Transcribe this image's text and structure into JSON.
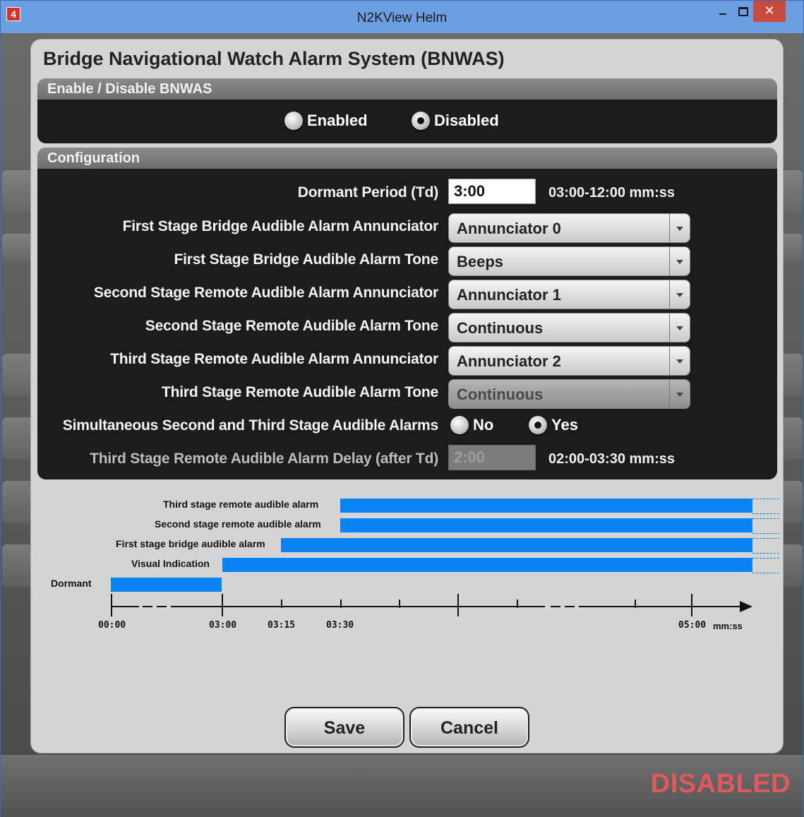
{
  "window": {
    "title": "N2KView Helm",
    "icon_glyph": "4",
    "close_glyph": "✕"
  },
  "status": {
    "disabled_label": "DISABLED",
    "color": "#e05a5a"
  },
  "dialog": {
    "title": "Bridge Navigational Watch Alarm System (BNWAS)",
    "enable_panel": {
      "header": "Enable / Disable BNWAS",
      "options": [
        {
          "label": "Enabled",
          "selected": false
        },
        {
          "label": "Disabled",
          "selected": true
        }
      ]
    },
    "config_panel": {
      "header": "Configuration",
      "dormant_period": {
        "label": "Dormant Period (Td)",
        "value": "3:00",
        "range": "03:00-12:00 mm:ss"
      },
      "selects": [
        {
          "label": "First Stage Bridge Audible Alarm Annunciator",
          "value": "Annunciator 0",
          "disabled": false
        },
        {
          "label": "First Stage Bridge Audible Alarm Tone",
          "value": "Beeps",
          "disabled": false
        },
        {
          "label": "Second Stage Remote Audible Alarm Annunciator",
          "value": "Annunciator 1",
          "disabled": false
        },
        {
          "label": "Second Stage Remote Audible Alarm Tone",
          "value": "Continuous",
          "disabled": false
        },
        {
          "label": "Third Stage Remote Audible Alarm Annunciator",
          "value": "Annunciator 2",
          "disabled": false
        },
        {
          "label": "Third Stage Remote Audible Alarm Tone",
          "value": "Continuous",
          "disabled": true
        }
      ],
      "simultaneous": {
        "label": "Simultaneous Second and Third Stage Audible Alarms",
        "options": [
          {
            "label": "No",
            "selected": false
          },
          {
            "label": "Yes",
            "selected": true
          }
        ]
      },
      "third_delay": {
        "label": "Third Stage Remote Audible Alarm Delay (after Td)",
        "value": "2:00",
        "range": "02:00-03:30 mm:ss",
        "disabled": true
      }
    },
    "timeline": {
      "rows": [
        {
          "label": "Third stage remote audible alarm"
        },
        {
          "label": "Second stage remote audible alarm"
        },
        {
          "label": "First stage bridge audible alarm"
        },
        {
          "label": "Visual Indication"
        },
        {
          "label": "Dormant"
        }
      ],
      "ticks": [
        "00:00",
        "03:00",
        "03:15",
        "03:30",
        "05:00",
        "mm:ss"
      ],
      "bar_color": "#0a84f5"
    },
    "buttons": {
      "save": "Save",
      "cancel": "Cancel"
    }
  }
}
